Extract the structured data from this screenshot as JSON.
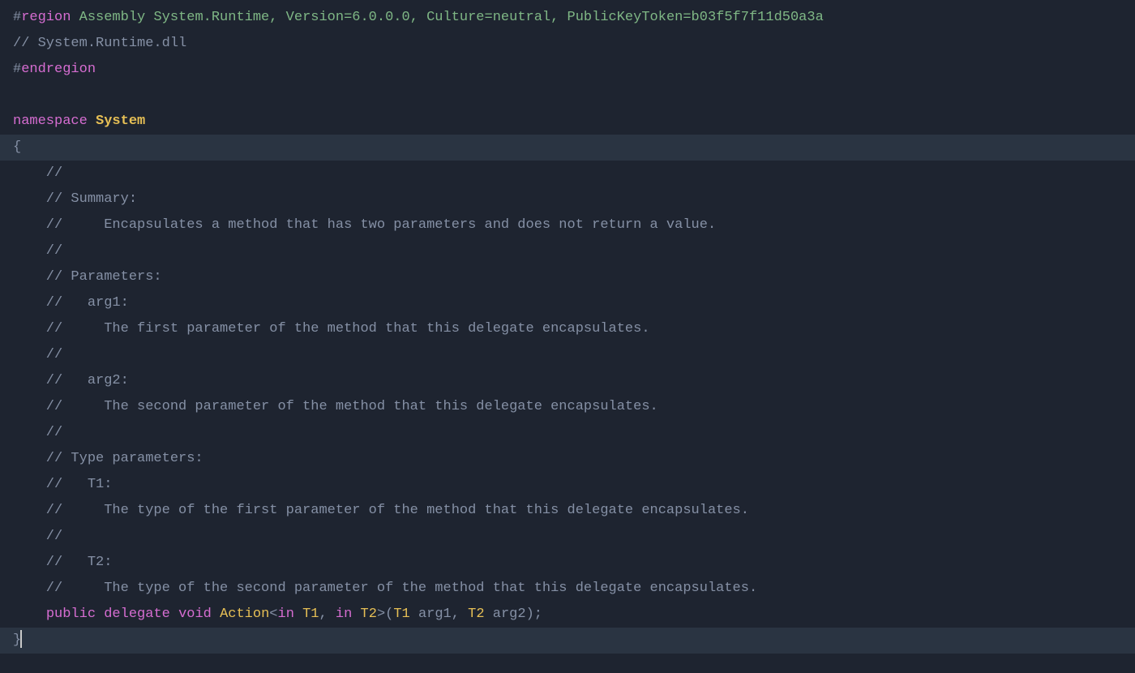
{
  "code": {
    "line1_hash": "#",
    "line1_region": "region",
    "line1_space": " ",
    "line1_text": "Assembly System.Runtime, Version=6.0.0.0, Culture=neutral, PublicKeyToken=b03f5f7f11d50a3a",
    "line2": "// System.Runtime.dll",
    "line3_hash": "#",
    "line3_endregion": "endregion",
    "line5_ns": "namespace",
    "line5_space": " ",
    "line5_name": "System",
    "line6": "{",
    "indent": "    ",
    "c1": "    //",
    "c2": "    // Summary:",
    "c3": "    //     Encapsulates a method that has two parameters and does not return a value.",
    "c4": "    //",
    "c5": "    // Parameters:",
    "c6": "    //   arg1:",
    "c7": "    //     The first parameter of the method that this delegate encapsulates.",
    "c8": "    //",
    "c9": "    //   arg2:",
    "c10": "    //     The second parameter of the method that this delegate encapsulates.",
    "c11": "    //",
    "c12": "    // Type parameters:",
    "c13": "    //   T1:",
    "c14": "    //     The type of the first parameter of the method that this delegate encapsulates.",
    "c15": "    //",
    "c16": "    //   T2:",
    "c17": "    //     The type of the second parameter of the method that this delegate encapsulates.",
    "sig_indent": "    ",
    "sig_public": "public",
    "sig_sp1": " ",
    "sig_delegate": "delegate",
    "sig_sp2": " ",
    "sig_void": "void",
    "sig_sp3": " ",
    "sig_action": "Action",
    "sig_lt": "<",
    "sig_in1": "in",
    "sig_sp4": " ",
    "sig_t1": "T1",
    "sig_comma1": ", ",
    "sig_in2": "in",
    "sig_sp5": " ",
    "sig_t2": "T2",
    "sig_gt": ">",
    "sig_lparen": "(",
    "sig_pt1": "T1",
    "sig_sp6": " ",
    "sig_arg1": "arg1",
    "sig_comma2": ", ",
    "sig_pt2": "T2",
    "sig_sp7": " ",
    "sig_arg2": "arg2",
    "sig_rparen": ")",
    "sig_semi": ";",
    "close": "}"
  }
}
